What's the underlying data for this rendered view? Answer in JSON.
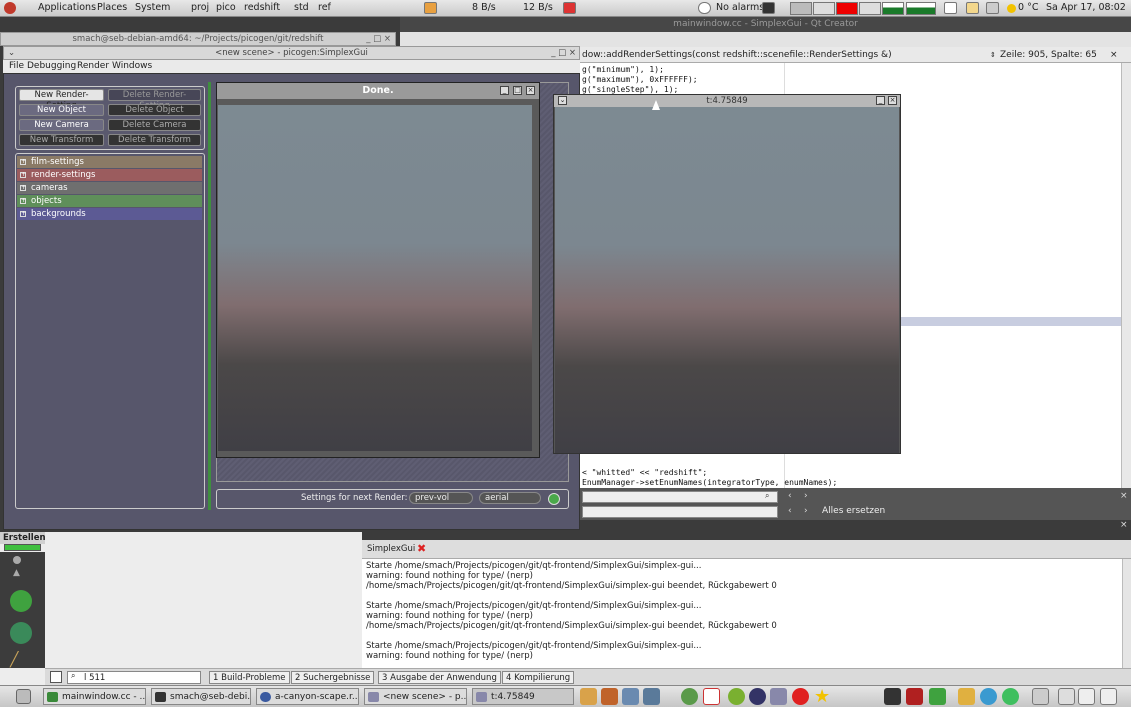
{
  "top_panel": {
    "apps": "Applications",
    "places": "Places",
    "system": "System",
    "launchers": [
      "proj",
      "pico",
      "redshift",
      "std",
      "ref"
    ],
    "net_down": "8 B/s",
    "net_up": "12 B/s",
    "alarms": "No alarms",
    "temp": "0 °C",
    "clock": "Sa Apr 17, 08:02"
  },
  "qtcreator": {
    "title": "mainwindow.cc - SimplexGui - Qt Creator",
    "func": "dow::addRenderSettings(const redshift::scenefile::RenderSettings &)",
    "position": "Zeile: 905, Spalte: 65",
    "code_top": [
      "g(\"minimum\"), 1);",
      "g(\"maximum\"), 0xFFFFFF);",
      "g(\"singleStep\"), 1);"
    ],
    "code_bottom": [
      "< \"whitted\" << \"redshift\";",
      "EnumManager->setEnumNames(integratorType, enumNames);"
    ],
    "replace_all": "Alles ersetzen",
    "build_dock": "Erstellen",
    "output_tab": "SimplexGui",
    "output_lines": [
      "Starte /home/smach/Projects/picogen/git/qt-frontend/SimplexGui/simplex-gui...",
      "warning: found nothing for type/ (nerp)",
      "/home/smach/Projects/picogen/git/qt-frontend/SimplexGui/simplex-gui beendet, Rückgabewert 0",
      "",
      "Starte /home/smach/Projects/picogen/git/qt-frontend/SimplexGui/simplex-gui...",
      "warning: found nothing for type/ (nerp)",
      "/home/smach/Projects/picogen/git/qt-frontend/SimplexGui/simplex-gui beendet, Rückgabewert 0",
      "",
      "Starte /home/smach/Projects/picogen/git/qt-frontend/SimplexGui/simplex-gui...",
      "warning: found nothing for type/ (nerp)"
    ],
    "locator": "l 511",
    "status_tabs": [
      {
        "n": "1",
        "label": "Build-Probleme"
      },
      {
        "n": "2",
        "label": "Suchergebnisse"
      },
      {
        "n": "3",
        "label": "Ausgabe der Anwendung"
      },
      {
        "n": "4",
        "label": "Kompilierung"
      }
    ]
  },
  "terminal": {
    "title": "smach@seb-debian-amd64: ~/Projects/picogen/git/redshift"
  },
  "simplexgui": {
    "title": "<new scene> - picogen:SimplexGui",
    "menu": [
      "File",
      "Debugging",
      "Render",
      "Windows"
    ],
    "buttons": [
      [
        "New Render-Setting",
        "Delete Render-Setting"
      ],
      [
        "New Object",
        "Delete Object"
      ],
      [
        "New Camera",
        "Delete Camera"
      ],
      [
        "New Transform",
        "Delete Transform"
      ]
    ],
    "tree": [
      {
        "label": "film-settings",
        "color": "#8a7a66"
      },
      {
        "label": "render-settings",
        "color": "#9b5c5e"
      },
      {
        "label": "cameras",
        "color": "#6f6f6f"
      },
      {
        "label": "objects",
        "color": "#5f8f5a"
      },
      {
        "label": "backgrounds",
        "color": "#5c5a94"
      }
    ],
    "render_window_title": "Done.",
    "settings_label": "Settings for next Render:",
    "settings_combo1": "prev-vol",
    "settings_combo2": "aerial"
  },
  "preview_window": {
    "title": "t:4.75849"
  },
  "taskbar": [
    "mainwindow.cc - ...",
    "smach@seb-debi...",
    "a-canyon-scape.r...",
    "<new scene> - p...",
    "t:4.75849"
  ]
}
